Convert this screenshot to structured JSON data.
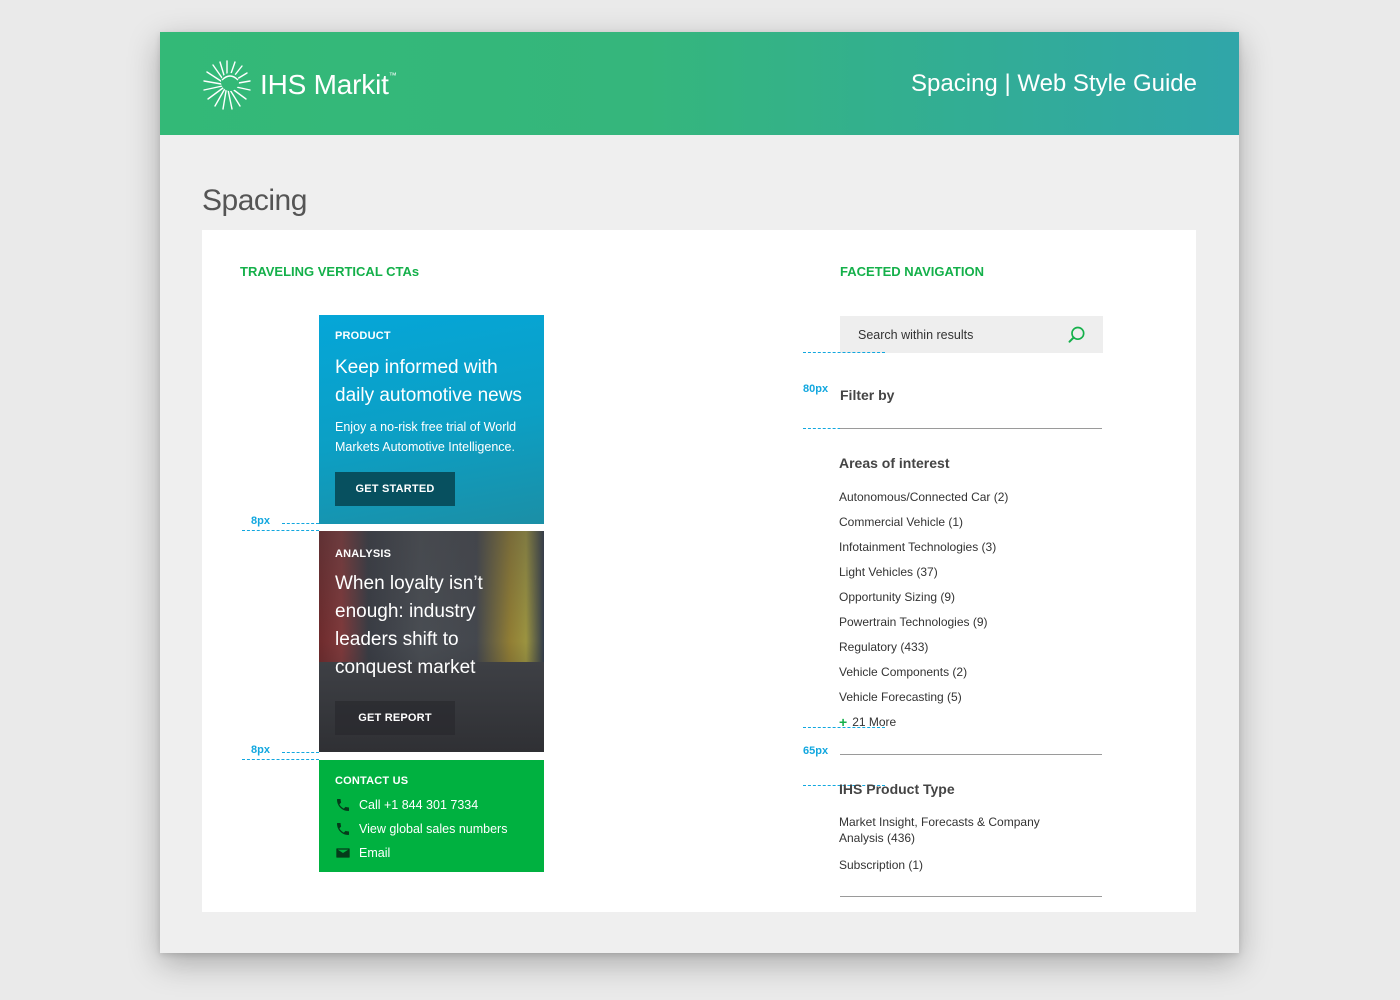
{
  "header": {
    "logo_text": "IHS Markit",
    "logo_tm": "™",
    "title": "Spacing | Web Style Guide"
  },
  "page": {
    "title": "Spacing"
  },
  "colors": {
    "brand_green": "#14b04a",
    "measure_blue": "#12a7df",
    "cta_blue": "#05a6d8",
    "cta_green": "#00b140"
  },
  "traveling_ctas": {
    "heading": "TRAVELING VERTICAL CTAs",
    "product": {
      "label": "PRODUCT",
      "headline": "Keep informed with daily automotive news",
      "body": "Enjoy a no-risk free trial of World Markets Automotive Intelligence.",
      "button": "GET STARTED"
    },
    "analysis": {
      "label": "ANALYSIS",
      "headline": "When loyalty isn’t enough: industry leaders shift to conquest market",
      "button": "GET REPORT"
    },
    "contact": {
      "label": "CONTACT US",
      "items": [
        {
          "icon": "phone-icon",
          "text": "Call +1 844 301 7334"
        },
        {
          "icon": "phone-icon",
          "text": "View global sales numbers"
        },
        {
          "icon": "mail-icon",
          "text": "Email"
        }
      ]
    },
    "spacing_labels": [
      "8px",
      "8px"
    ]
  },
  "faceted_navigation": {
    "heading": "FACETED NAVIGATION",
    "search_placeholder": "Search within results",
    "filter_by": "Filter by",
    "spacing_labels": [
      "80px",
      "65px"
    ],
    "areas_of_interest": {
      "title": "Areas of interest",
      "items": [
        "Autonomous/Connected Car (2)",
        "Commercial Vehicle (1)",
        "Infotainment Technologies (3)",
        "Light Vehicles (37)",
        "Opportunity Sizing (9)",
        "Powertrain Technologies (9)",
        "Regulatory (433)",
        "Vehicle Components (2)",
        "Vehicle Forecasting (5)"
      ],
      "more": "21 More"
    },
    "product_type": {
      "title": "IHS Product Type",
      "items": [
        "Market Insight, Forecasts & Company Analysis (436)",
        "Subscription (1)"
      ]
    }
  }
}
